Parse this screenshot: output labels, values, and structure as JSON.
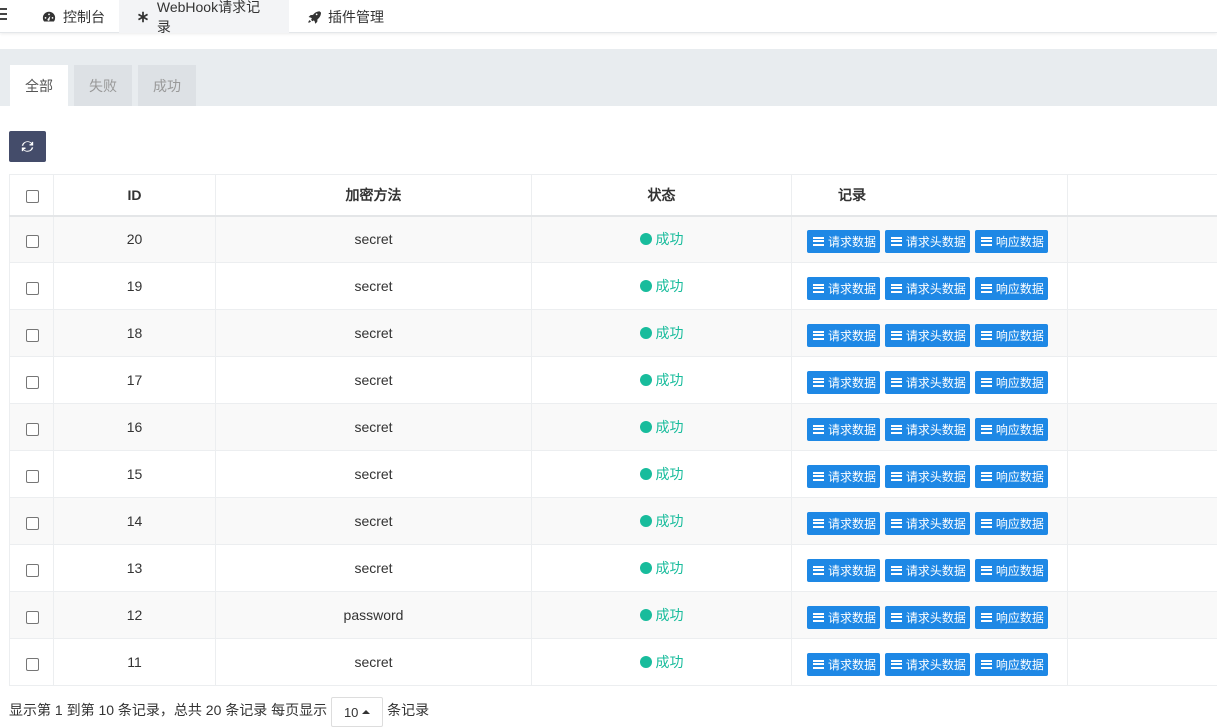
{
  "topnav": {
    "tabs": [
      {
        "label": "控制台",
        "icon": "dashboard-icon"
      },
      {
        "label": "WebHook请求记录",
        "icon": "asterisk-icon"
      },
      {
        "label": "插件管理",
        "icon": "rocket-icon"
      }
    ]
  },
  "filter_tabs": [
    "全部",
    "失败",
    "成功"
  ],
  "table": {
    "headers": {
      "id": "ID",
      "method": "加密方法",
      "status": "状态",
      "record": "记录"
    },
    "buttons": {
      "request": "请求数据",
      "headers": "请求头数据",
      "response": "响应数据"
    },
    "rows": [
      {
        "id": "20",
        "method": "secret",
        "status": "成功"
      },
      {
        "id": "19",
        "method": "secret",
        "status": "成功"
      },
      {
        "id": "18",
        "method": "secret",
        "status": "成功"
      },
      {
        "id": "17",
        "method": "secret",
        "status": "成功"
      },
      {
        "id": "16",
        "method": "secret",
        "status": "成功"
      },
      {
        "id": "15",
        "method": "secret",
        "status": "成功"
      },
      {
        "id": "14",
        "method": "secret",
        "status": "成功"
      },
      {
        "id": "13",
        "method": "secret",
        "status": "成功"
      },
      {
        "id": "12",
        "method": "password",
        "status": "成功"
      },
      {
        "id": "11",
        "method": "secret",
        "status": "成功"
      }
    ]
  },
  "pager": {
    "summary": "显示第 1 到第 10 条记录，总共 20 条记录 每页显示",
    "page_size": "10",
    "suffix": "条记录"
  },
  "colors": {
    "success": "#18bc9c",
    "button_blue": "#1e88e5",
    "refresh_bg": "#444c6a"
  }
}
